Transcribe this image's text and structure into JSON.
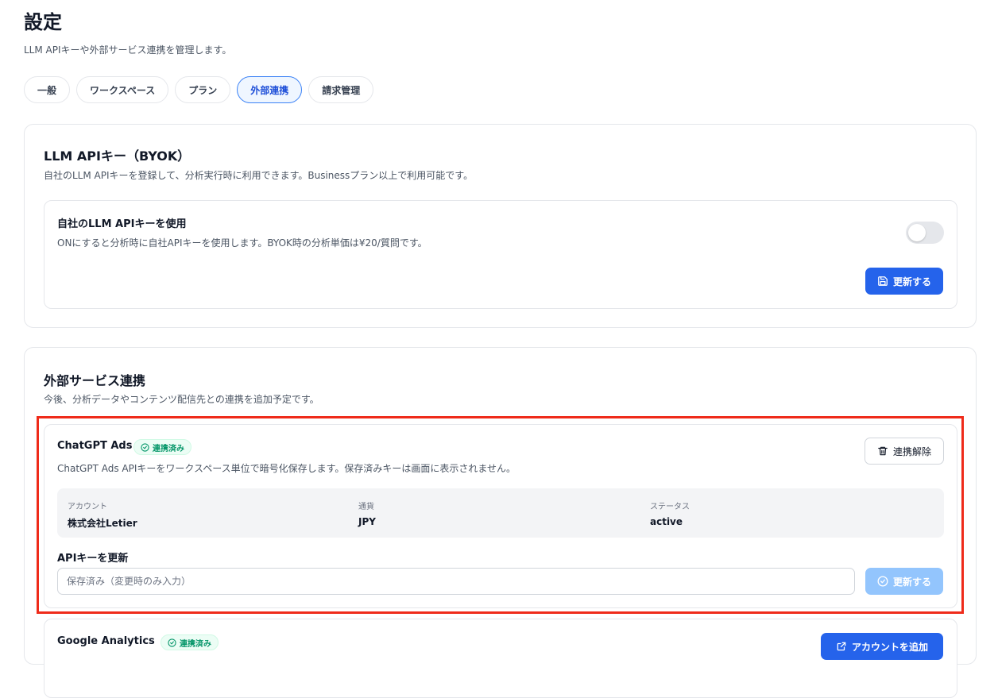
{
  "page": {
    "title": "設定",
    "subtitle": "LLM APIキーや外部サービス連携を管理します。"
  },
  "tabs": [
    {
      "label": "一般"
    },
    {
      "label": "ワークスペース"
    },
    {
      "label": "プラン"
    },
    {
      "label": "外部連携",
      "active": true
    },
    {
      "label": "請求管理"
    }
  ],
  "llm_card": {
    "title": "LLM APIキー（BYOK）",
    "description": "自社のLLM APIキーを登録して、分析実行時に利用できます。Businessプラン以上で利用可能です。",
    "setting": {
      "title": "自社のLLM APIキーを使用",
      "description": "ONにすると分析時に自社APIキーを使用します。BYOK時の分析単価は¥20/質問です。",
      "toggle_on": false
    },
    "update_button": "更新する"
  },
  "external_card": {
    "title": "外部サービス連携",
    "description": "今後、分析データやコンテンツ配信先との連携を追加予定です。",
    "chatgpt": {
      "name": "ChatGPT Ads",
      "badge": "連携済み",
      "description": "ChatGPT Ads APIキーをワークスペース単位で暗号化保存します。保存済みキーは画面に表示されません。",
      "disconnect_button": "連携解除",
      "info": [
        {
          "label": "アカウント",
          "value": "株式会社Letier"
        },
        {
          "label": "通貨",
          "value": "JPY"
        },
        {
          "label": "ステータス",
          "value": "active"
        }
      ],
      "api_key_label": "APIキーを更新",
      "api_key_placeholder": "保存済み（変更時のみ入力）",
      "update_button": "更新する"
    },
    "google_analytics": {
      "name": "Google Analytics",
      "badge": "連携済み",
      "add_account_button": "アカウントを追加"
    }
  },
  "colors": {
    "accent": "#2563eb",
    "accent_disabled": "#93c5fd",
    "success": "#059669",
    "highlight": "#ef2b1a"
  }
}
